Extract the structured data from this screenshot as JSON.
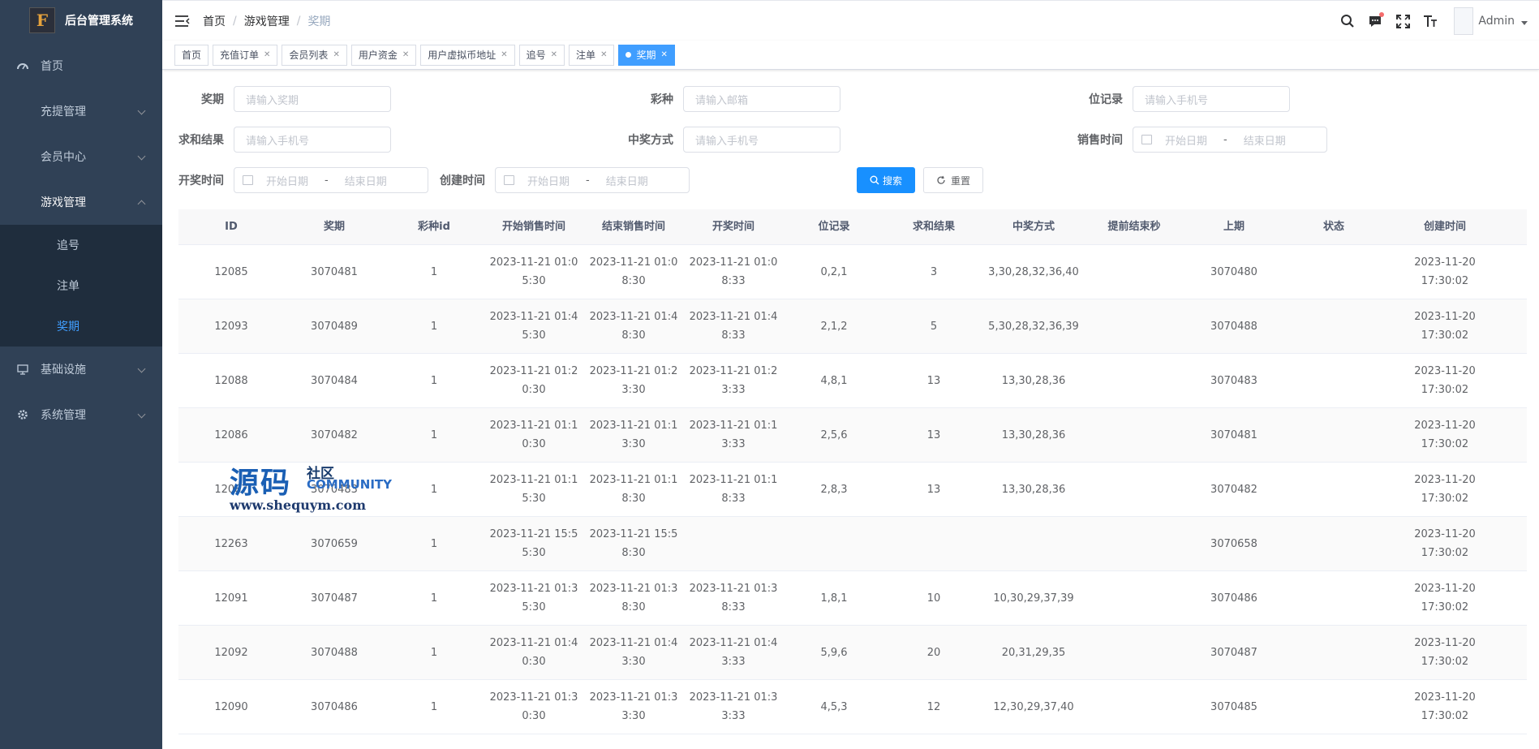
{
  "sidebar": {
    "logo_mark": "F",
    "title": "后台管理系统",
    "items": [
      {
        "label": "首页"
      },
      {
        "label": "充提管理"
      },
      {
        "label": "会员中心"
      },
      {
        "label": "游戏管理"
      },
      {
        "label": "基础设施"
      },
      {
        "label": "系统管理"
      }
    ],
    "sub_items": [
      {
        "label": "追号"
      },
      {
        "label": "注单"
      },
      {
        "label": "奖期"
      }
    ]
  },
  "navbar": {
    "breadcrumb": [
      "首页",
      "游戏管理",
      "奖期"
    ],
    "breadcrumb_sep": "/",
    "user": "Admin"
  },
  "tags": [
    "首页",
    "充值订单",
    "会员列表",
    "用户资金",
    "用户虚拟币地址",
    "追号",
    "注单",
    "奖期"
  ],
  "form": {
    "period_label": "奖期",
    "period_placeholder": "请输入奖期",
    "lottery_label": "彩种",
    "lottery_placeholder": "请输入邮箱",
    "record_label": "位记录",
    "record_placeholder": "请输入手机号",
    "sum_label": "求和结果",
    "sum_placeholder": "请输入手机号",
    "win_label": "中奖方式",
    "win_placeholder": "请输入手机号",
    "sale_label": "销售时间",
    "draw_label": "开奖时间",
    "create_label": "创建时间",
    "start_date": "开始日期",
    "end_date": "结束日期",
    "range_sep": "-",
    "search_btn": "搜索",
    "reset_btn": "重置"
  },
  "table": {
    "headers": [
      "ID",
      "奖期",
      "彩种id",
      "开始销售时间",
      "结束销售时间",
      "开奖时间",
      "位记录",
      "求和结果",
      "中奖方式",
      "提前结束秒",
      "上期",
      "状态",
      "创建时间"
    ],
    "rows": [
      [
        "12085",
        "3070481",
        "1",
        "2023-11-21 01:0\n5:30",
        "2023-11-21 01:0\n8:30",
        "2023-11-21 01:0\n8:33",
        "0,2,1",
        "3",
        "3,30,28,32,36,40",
        "",
        "3070480",
        "",
        "2023-11-20 17:30:02"
      ],
      [
        "12093",
        "3070489",
        "1",
        "2023-11-21 01:4\n5:30",
        "2023-11-21 01:4\n8:30",
        "2023-11-21 01:4\n8:33",
        "2,1,2",
        "5",
        "5,30,28,32,36,39",
        "",
        "3070488",
        "",
        "2023-11-20 17:30:02"
      ],
      [
        "12088",
        "3070484",
        "1",
        "2023-11-21 01:2\n0:30",
        "2023-11-21 01:2\n3:30",
        "2023-11-21 01:2\n3:33",
        "4,8,1",
        "13",
        "13,30,28,36",
        "",
        "3070483",
        "",
        "2023-11-20 17:30:02"
      ],
      [
        "12086",
        "3070482",
        "1",
        "2023-11-21 01:1\n0:30",
        "2023-11-21 01:1\n3:30",
        "2023-11-21 01:1\n3:33",
        "2,5,6",
        "13",
        "13,30,28,36",
        "",
        "3070481",
        "",
        "2023-11-20 17:30:02"
      ],
      [
        "12087",
        "3070483",
        "1",
        "2023-11-21 01:1\n5:30",
        "2023-11-21 01:1\n8:30",
        "2023-11-21 01:1\n8:33",
        "2,8,3",
        "13",
        "13,30,28,36",
        "",
        "3070482",
        "",
        "2023-11-20 17:30:02"
      ],
      [
        "12263",
        "3070659",
        "1",
        "2023-11-21 15:5\n5:30",
        "2023-11-21 15:5\n8:30",
        "",
        "",
        "",
        "",
        "",
        "3070658",
        "",
        "2023-11-20 17:30:02"
      ],
      [
        "12091",
        "3070487",
        "1",
        "2023-11-21 01:3\n5:30",
        "2023-11-21 01:3\n8:30",
        "2023-11-21 01:3\n8:33",
        "1,8,1",
        "10",
        "10,30,29,37,39",
        "",
        "3070486",
        "",
        "2023-11-20 17:30:02"
      ],
      [
        "12092",
        "3070488",
        "1",
        "2023-11-21 01:4\n0:30",
        "2023-11-21 01:4\n3:30",
        "2023-11-21 01:4\n3:33",
        "5,9,6",
        "20",
        "20,31,29,35",
        "",
        "3070487",
        "",
        "2023-11-20 17:30:02"
      ],
      [
        "12090",
        "3070486",
        "1",
        "2023-11-21 01:3\n0:30",
        "2023-11-21 01:3\n3:30",
        "2023-11-21 01:3\n3:33",
        "4,5,3",
        "12",
        "12,30,29,37,40",
        "",
        "3070485",
        "",
        "2023-11-20 17:30:02"
      ]
    ]
  },
  "watermark": {
    "big": "源码",
    "small": "社区",
    "community": "COMMUNITY",
    "url": "www.shequym.com"
  },
  "colors": {
    "sidebar_bg": "#304156",
    "submenu_bg": "#1f2d3d",
    "accent": "#409eff",
    "primary_button": "#1890ff"
  }
}
